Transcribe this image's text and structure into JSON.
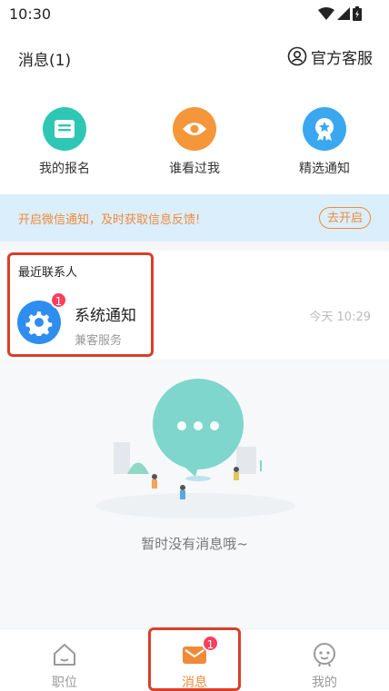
{
  "status_bar": {
    "time": "10:30"
  },
  "header": {
    "title": "消息(1)",
    "service_label": "官方客服"
  },
  "actions": [
    {
      "label": "我的报名",
      "icon": "clipboard-icon",
      "color": "#2ec7b3"
    },
    {
      "label": "谁看过我",
      "icon": "eye-icon",
      "color": "#f5963a"
    },
    {
      "label": "精选通知",
      "icon": "badge-star-icon",
      "color": "#3aa7f0"
    }
  ],
  "banner": {
    "text": "开启微信通知，及时获取信息反馈!",
    "button": "去开启"
  },
  "recent": {
    "title": "最近联系人",
    "contact": {
      "name": "系统通知",
      "subtitle": "兼客服务",
      "time": "今天 10:29",
      "badge": "1"
    }
  },
  "empty": {
    "text": "暂时没有消息哦~"
  },
  "tabbar": {
    "tabs": [
      {
        "label": "职位",
        "icon": "home-icon",
        "active": false
      },
      {
        "label": "消息",
        "icon": "mail-icon",
        "active": true,
        "badge": "1"
      },
      {
        "label": "我的",
        "icon": "face-icon",
        "active": false
      }
    ]
  },
  "colors": {
    "accent": "#f08a3b",
    "badge": "#ff3d5c",
    "banner_bg": "#dbeefb",
    "highlight": "#d8402a"
  }
}
